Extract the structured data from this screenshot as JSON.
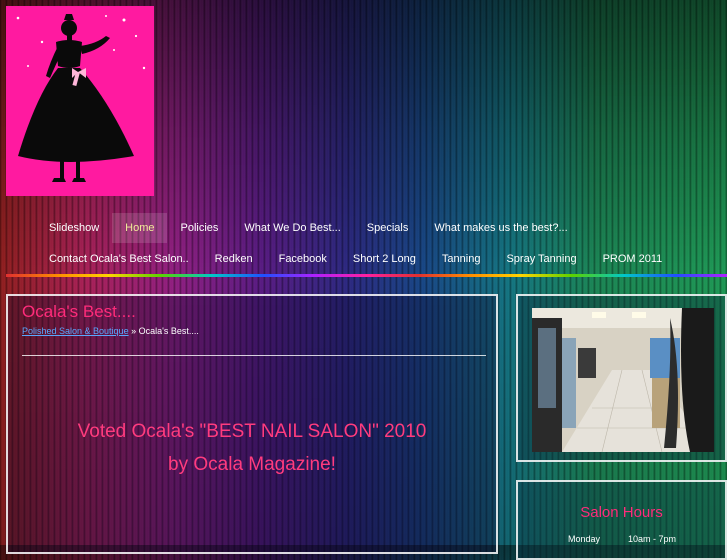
{
  "nav": {
    "row1": [
      {
        "label": "Slideshow",
        "active": false
      },
      {
        "label": "Home",
        "active": true
      },
      {
        "label": "Policies",
        "active": false
      },
      {
        "label": "What We Do Best...",
        "active": false
      },
      {
        "label": "Specials",
        "active": false
      },
      {
        "label": "What makes us the best?...",
        "active": false
      }
    ],
    "row2": [
      {
        "label": "Contact Ocala's Best Salon..",
        "active": false
      },
      {
        "label": "Redken",
        "active": false
      },
      {
        "label": "Facebook",
        "active": false
      },
      {
        "label": "Short 2 Long",
        "active": false
      },
      {
        "label": "Tanning",
        "active": false
      },
      {
        "label": "Spray Tanning",
        "active": false
      },
      {
        "label": "PROM 2011",
        "active": false
      }
    ]
  },
  "main": {
    "title": "Ocala's Best....",
    "breadcrumb_link": "Polished Salon & Boutique",
    "breadcrumb_sep": " » ",
    "breadcrumb_current": "Ocala's Best....",
    "voted_line1": "Voted Ocala's \"BEST NAIL SALON\" 2010",
    "voted_line2": "by Ocala Magazine!"
  },
  "sidebar": {
    "hours_title": "Salon Hours",
    "hours_day": "Monday",
    "hours_time": "10am - 7pm"
  },
  "colors": {
    "accent_pink": "#ff2b7a",
    "logo_bg": "#ff1aa0",
    "link_blue": "#5aa8ff",
    "active_nav": "#f2ec9a"
  },
  "icons": [
    "logo-silhouette-icon"
  ]
}
